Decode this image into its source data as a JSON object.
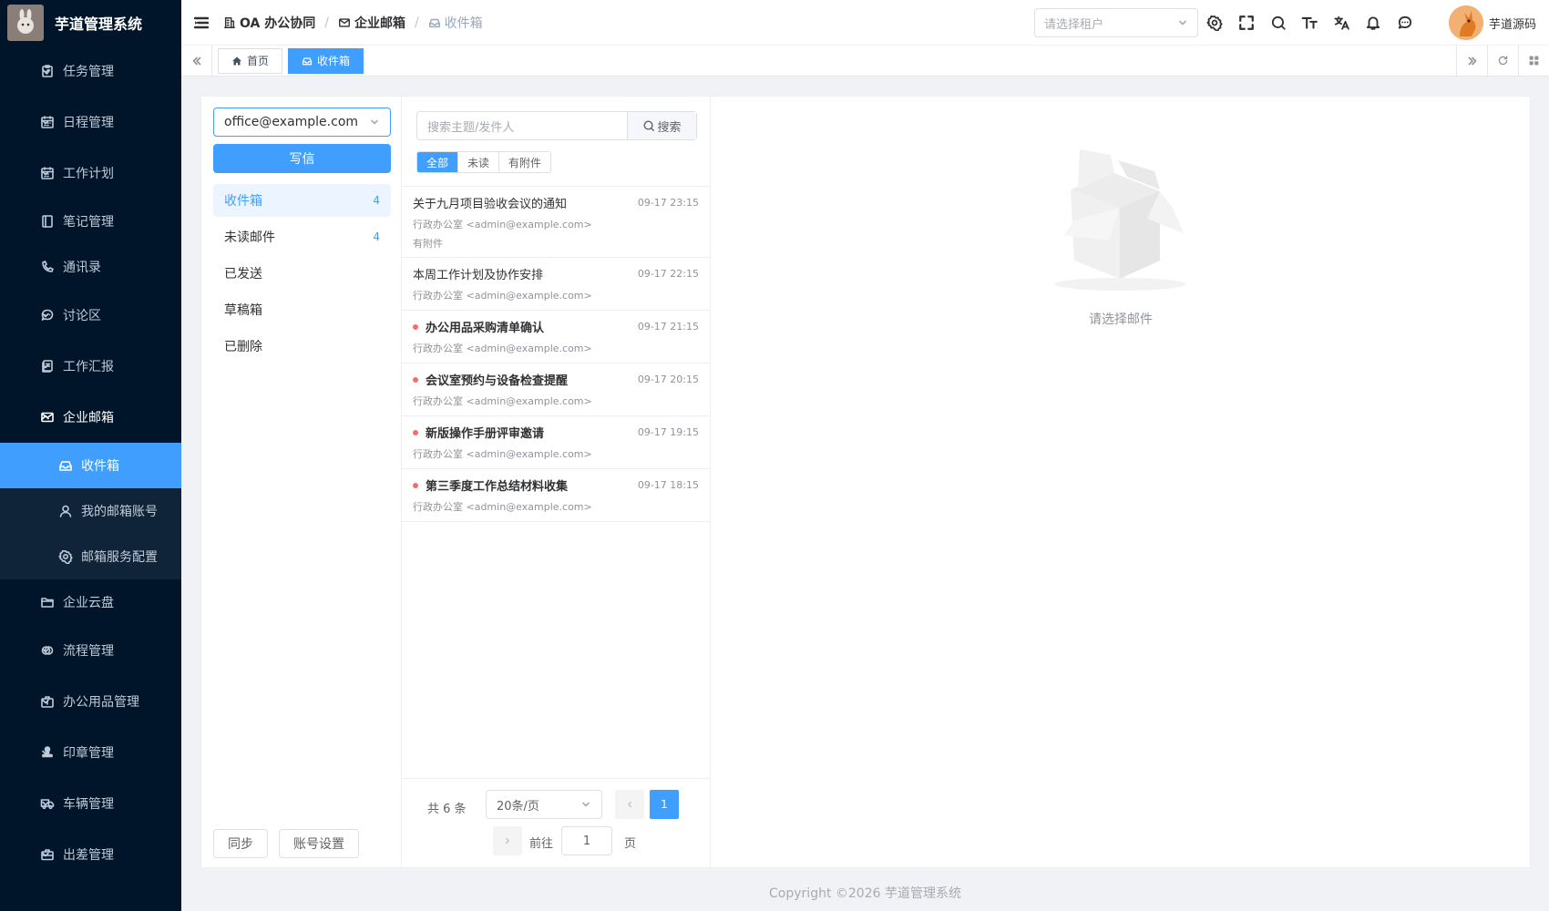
{
  "app": {
    "title": "芋道管理系统"
  },
  "sidebar": {
    "items": [
      {
        "label": "任务管理",
        "icon": "clipboard-check-icon"
      },
      {
        "label": "日程管理",
        "icon": "calendar-icon"
      },
      {
        "label": "工作计划",
        "icon": "calendar-icon"
      },
      {
        "label": "笔记管理",
        "icon": "notebook-icon"
      },
      {
        "label": "通讯录",
        "icon": "phone-icon"
      },
      {
        "label": "讨论区",
        "icon": "chat-icon"
      },
      {
        "label": "工作汇报",
        "icon": "report-icon"
      },
      {
        "label": "企业邮箱",
        "icon": "mail-icon"
      },
      {
        "label": "收件箱",
        "icon": "inbox-icon"
      },
      {
        "label": "我的邮箱账号",
        "icon": "user-icon"
      },
      {
        "label": "邮箱服务配置",
        "icon": "gear-icon"
      },
      {
        "label": "企业云盘",
        "icon": "folder-icon"
      },
      {
        "label": "流程管理",
        "icon": "workflow-icon"
      },
      {
        "label": "办公用品管理",
        "icon": "briefcase-icon"
      },
      {
        "label": "印章管理",
        "icon": "stamp-icon"
      },
      {
        "label": "车辆管理",
        "icon": "truck-icon"
      },
      {
        "label": "出差管理",
        "icon": "suitcase-icon"
      }
    ]
  },
  "header": {
    "breadcrumb": [
      {
        "label": "OA 办公协同",
        "icon": "building-icon"
      },
      {
        "label": "企业邮箱",
        "icon": "mail-icon"
      },
      {
        "label": "收件箱",
        "icon": "inbox-icon"
      }
    ],
    "tenant_placeholder": "请选择租户",
    "user_name": "芋道源码"
  },
  "tags": [
    {
      "label": "首页",
      "icon": "home-icon"
    },
    {
      "label": "收件箱",
      "icon": "inbox-icon"
    }
  ],
  "mailbox": {
    "account": "office@example.com",
    "compose_label": "写信",
    "folders": [
      {
        "label": "收件箱",
        "count": "4"
      },
      {
        "label": "未读邮件",
        "count": "4"
      },
      {
        "label": "已发送",
        "count": ""
      },
      {
        "label": "草稿箱",
        "count": ""
      },
      {
        "label": "已删除",
        "count": ""
      }
    ],
    "sync_label": "同步",
    "account_settings_label": "账号设置"
  },
  "list": {
    "search_placeholder": "搜索主题/发件人",
    "search_label": "搜索",
    "filters": [
      "全部",
      "未读",
      "有附件"
    ],
    "mails": [
      {
        "subject": "关于九月项目验收会议的通知",
        "time": "09-17 23:15",
        "from": "行政办公室 <admin@example.com>",
        "attachment": "有附件",
        "unread": false
      },
      {
        "subject": "本周工作计划及协作安排",
        "time": "09-17 22:15",
        "from": "行政办公室 <admin@example.com>",
        "attachment": "",
        "unread": false
      },
      {
        "subject": "办公用品采购清单确认",
        "time": "09-17 21:15",
        "from": "行政办公室 <admin@example.com>",
        "attachment": "",
        "unread": true
      },
      {
        "subject": "会议室预约与设备检查提醒",
        "time": "09-17 20:15",
        "from": "行政办公室 <admin@example.com>",
        "attachment": "",
        "unread": true
      },
      {
        "subject": "新版操作手册评审邀请",
        "time": "09-17 19:15",
        "from": "行政办公室 <admin@example.com>",
        "attachment": "",
        "unread": true
      },
      {
        "subject": "第三季度工作总结材料收集",
        "time": "09-17 18:15",
        "from": "行政办公室 <admin@example.com>",
        "attachment": "",
        "unread": true
      }
    ],
    "pager": {
      "total": "共 6 条",
      "page_size": "20条/页",
      "current_page": "1",
      "goto_label": "前往",
      "goto_value": "1",
      "goto_unit": "页"
    }
  },
  "detail": {
    "empty_text": "请选择邮件"
  },
  "footer": {
    "copyright": "Copyright ©2026 芋道管理系统"
  },
  "colors": {
    "primary": "#409eff",
    "sidebar_bg": "#001529",
    "unread_dot": "#f56c6c"
  }
}
